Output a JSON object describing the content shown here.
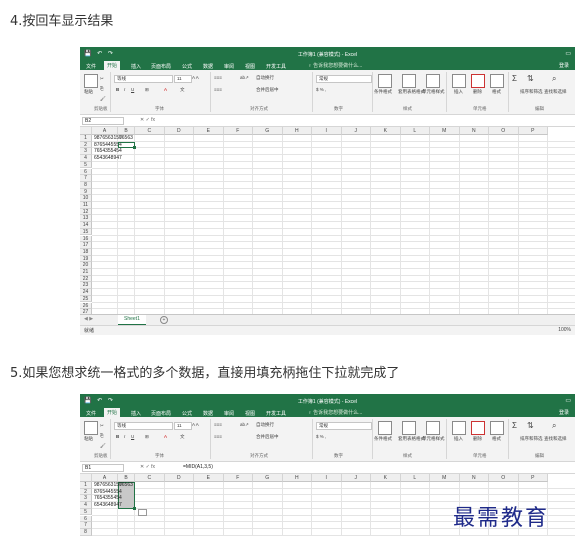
{
  "steps": [
    {
      "text": "4.按回车显示结果"
    },
    {
      "text": "5.如果您想求统一格式的多个数据，直接用填充柄拖住下拉就完成了"
    }
  ],
  "excel": {
    "title": "工作簿1 (兼容模式) - Excel",
    "tabs": [
      "文件",
      "开始",
      "插入",
      "页面布局",
      "公式",
      "数据",
      "审阅",
      "视图",
      "开发工具"
    ],
    "active_tab": "开始",
    "tell_me": "♀ 告诉我您想要做什么...",
    "share": "登录",
    "ribbon": {
      "paste": "粘贴",
      "font_name": "等线",
      "font_size": "11",
      "wrap_text": "自动换行",
      "merge_center": "合并后居中",
      "number_format": "常规",
      "cond_format": "条件格式",
      "table_format": "套用表格格式",
      "cell_styles": "单元格样式",
      "insert": "插入",
      "delete": "删除",
      "format": "格式",
      "sort_filter": "排序和筛选",
      "find_select": "查找和选择",
      "groups": [
        "剪贴板",
        "字体",
        "对齐方式",
        "数字",
        "样式",
        "单元格",
        "编辑"
      ]
    },
    "columns": [
      "A",
      "B",
      "C",
      "D",
      "E",
      "F",
      "G",
      "H",
      "I",
      "J",
      "K",
      "L",
      "M",
      "N",
      "O",
      "P"
    ],
    "sheet_tab": "Sheet1",
    "status_ready": "就绪",
    "zoom": "100%"
  },
  "screenshot1": {
    "namebox": "B2",
    "formula": "",
    "rows": [
      "1",
      "2",
      "3",
      "4",
      "5",
      "6",
      "7",
      "8",
      "9",
      "10",
      "11",
      "12",
      "13",
      "14",
      "15",
      "16",
      "17",
      "18",
      "19",
      "20",
      "21",
      "22",
      "23",
      "24",
      "25",
      "26",
      "27"
    ],
    "a_values": [
      "9876563150",
      "8765445554",
      "7654355454",
      "6543648947"
    ],
    "b_values": [
      "76563"
    ]
  },
  "screenshot2": {
    "namebox": "B1",
    "formula": "=MID(A1,3,5)",
    "rows": [
      "1",
      "2",
      "3",
      "4",
      "5",
      "6",
      "7",
      "8"
    ],
    "a_values": [
      "9876563150",
      "8765445554",
      "7654355454",
      "6543648947"
    ],
    "b_values": [
      "76563"
    ]
  },
  "watermark": "最需教育"
}
